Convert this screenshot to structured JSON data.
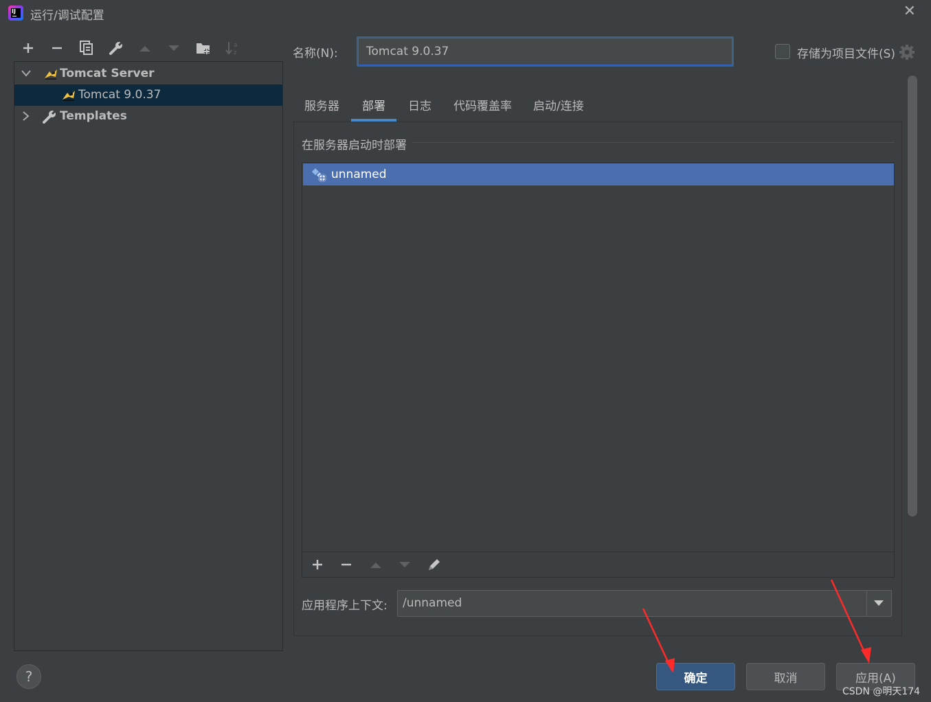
{
  "window": {
    "title": "运行/调试配置",
    "close_glyph": "✕"
  },
  "toolbar": {
    "icons": [
      "plus-icon",
      "minus-icon",
      "copy-icon",
      "wrench-icon",
      "arrow-up-icon",
      "arrow-down-icon",
      "folder-add-icon",
      "sort-az-icon"
    ]
  },
  "tree": {
    "group_label": "Tomcat Server",
    "item_label": "Tomcat 9.0.37",
    "templates_label": "Templates"
  },
  "name_field": {
    "label": "名称(N):",
    "value": "Tomcat 9.0.37"
  },
  "store_option": {
    "label": "存储为项目文件(S)",
    "checked": false
  },
  "tabs": [
    {
      "label": "服务器",
      "active": false
    },
    {
      "label": "部署",
      "active": true
    },
    {
      "label": "日志",
      "active": false
    },
    {
      "label": "代码覆盖率",
      "active": false
    },
    {
      "label": "启动/连接",
      "active": false
    }
  ],
  "deploy": {
    "section_title": "在服务器启动时部署",
    "items": [
      {
        "label": "unnamed",
        "selected": true
      }
    ]
  },
  "context": {
    "label": "应用程序上下文:",
    "value": "/unnamed"
  },
  "buttons": {
    "help": "?",
    "ok": "确定",
    "cancel": "取消",
    "apply": "应用(A)"
  },
  "watermark": "CSDN @明天174",
  "colors": {
    "background": "#3c3f41",
    "selection": "#4b6eaf",
    "tree_selection": "#0d293e",
    "accent": "#4a88c7",
    "annotation_arrow": "#ff2a2a"
  }
}
